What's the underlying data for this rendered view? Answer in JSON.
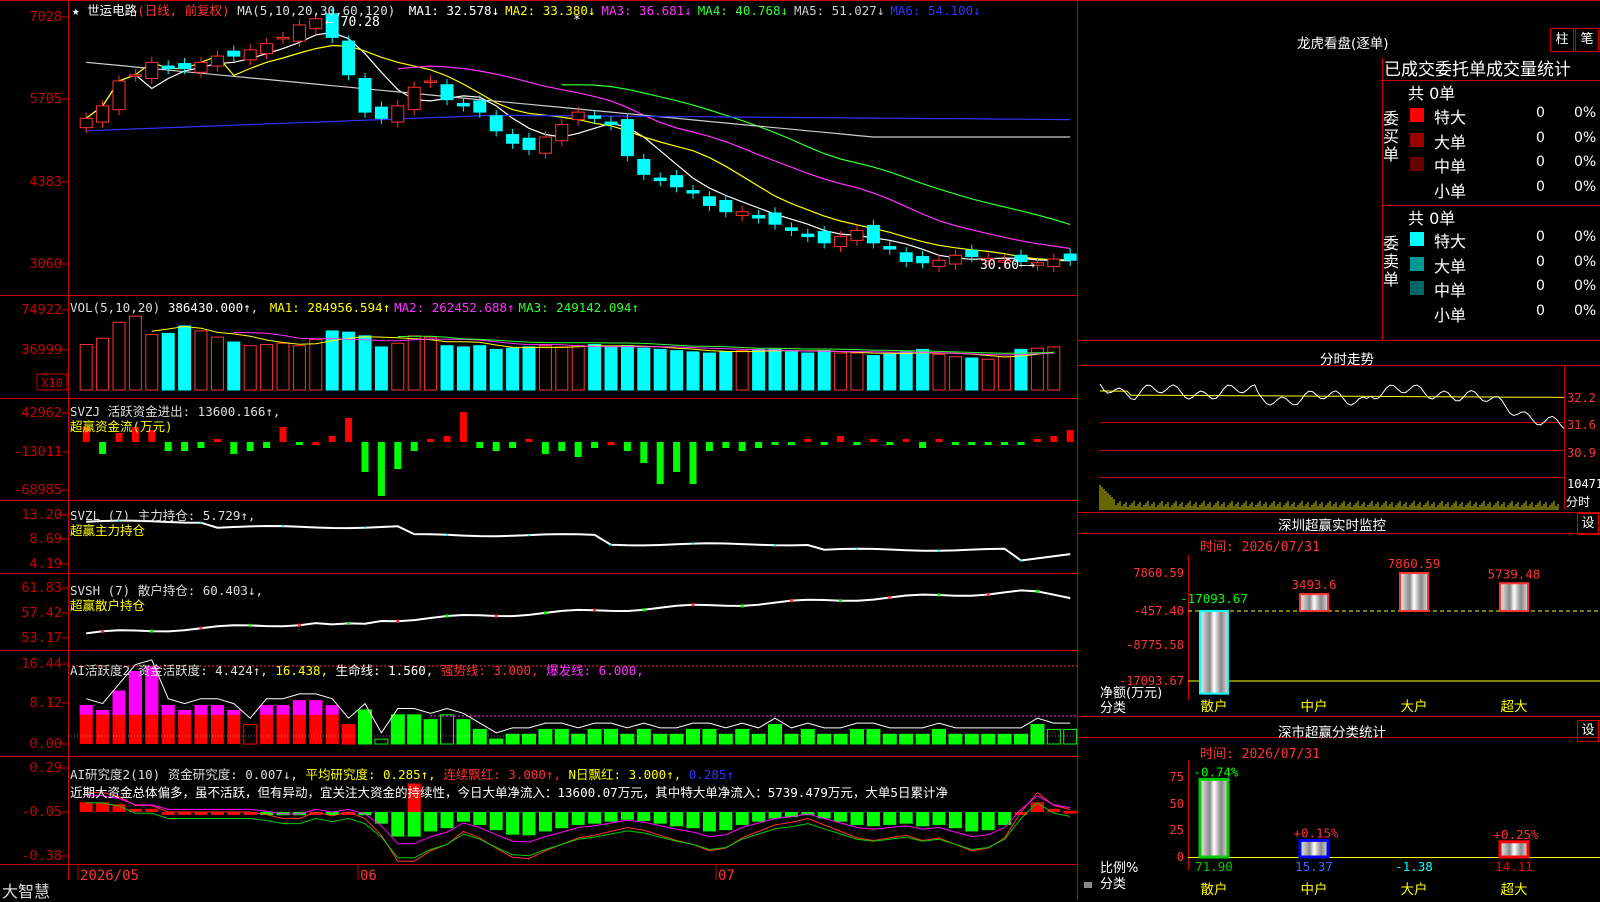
{
  "stock": {
    "name": "世运电路",
    "period_label": "(日线, 前复权)",
    "star": "★",
    "ma_header": "MA(5,10,20,30,60,120)",
    "ma": [
      {
        "label": "MA1:",
        "value": "32.578↓",
        "color": "#ffffff"
      },
      {
        "label": "MA2:",
        "value": "33.380↓",
        "color": "#ffff00"
      },
      {
        "label": "MA3:",
        "value": "36.681↓",
        "color": "#ff33ff"
      },
      {
        "label": "MA4:",
        "value": "40.768↓",
        "color": "#33ff33"
      },
      {
        "label": "MA5:",
        "value": "51.027↓",
        "color": "#cccccc"
      },
      {
        "label": "MA6:",
        "value": "54.100↓",
        "color": "#3333ff"
      }
    ],
    "price_axis": [
      "7028",
      "5705",
      "4383",
      "3060"
    ],
    "high_marker": "70.28",
    "low_marker": "30.60"
  },
  "vol": {
    "header": "VOL(5,10,20)",
    "value": "386430.000↑",
    "ma": [
      {
        "label": "MA1:",
        "value": "284956.594↑",
        "color": "#ffff00"
      },
      {
        "label": "MA2:",
        "value": "262452.688↑",
        "color": "#ff33ff"
      },
      {
        "label": "MA3:",
        "value": "249142.094↑",
        "color": "#33ff33"
      }
    ],
    "axis": [
      "74922",
      "36999"
    ],
    "unit": "X10"
  },
  "svzj": {
    "header": "SVZJ  活跃资金进出: 13600.166↑,",
    "sub": "超赢资金流(万元)",
    "axis": [
      "42962",
      "-13011",
      "-68985"
    ]
  },
  "svzl": {
    "header": "SVZL (7) 主力持仓: 5.729↑,",
    "sub": "超赢主力持仓",
    "axis": [
      "13.20",
      "8.69",
      "4.19"
    ]
  },
  "svsh": {
    "header": "SVSH (7) 散户持仓: 60.403↓,",
    "sub": "超赢散户持仓",
    "axis": [
      "61.83",
      "57.42",
      "53.17"
    ]
  },
  "ai1": {
    "header_a": "AI活跃度2 资金活跃度: 4.424↑,",
    "header_b": "16.438,",
    "header_c": "生命线: 1.560,",
    "header_d": "强势线: 3.000,",
    "header_e": "爆发线: 6.000,",
    "axis": [
      "16.44",
      "8.12",
      "0.00"
    ]
  },
  "ai2": {
    "header_a": "AI研究度2(10) 资金研究度: 0.007↓,",
    "header_b": "平均研究度: 0.285↑,",
    "header_c": "连续飘红: 3.000↑,",
    "header_d": "N日飘红: 3.000↑,",
    "header_e": "0.285↑",
    "comment": "近期大资金总体偏多，虽不活跃，但有异动，宜关注大资金的持续性，今日大单净流入：13600.07万元，其中特大单净流入：5739.479万元，大单5日累计净",
    "axis": [
      "0.29",
      "-0.05",
      "-0.38"
    ]
  },
  "footer": {
    "brand": "大智慧",
    "dates": [
      "2026/05",
      "06",
      "07"
    ]
  },
  "dragon": {
    "title": "龙虎看盘(逐单)",
    "btn_bar": "柱",
    "btn_pen": "笔",
    "subtitle": "已成交委托单成交量统计",
    "buy_side": "委买单",
    "sell_side": "委卖单",
    "buy_total": "共 0单",
    "sell_total": "共 0单",
    "buy_rows": [
      {
        "label": "特大",
        "count": "0",
        "pct": "0%",
        "color": "#ff0000"
      },
      {
        "label": "大单",
        "count": "0",
        "pct": "0%",
        "color": "#990000"
      },
      {
        "label": "中单",
        "count": "0",
        "pct": "0%",
        "color": "#660000"
      },
      {
        "label": "小单",
        "count": "0",
        "pct": "0%",
        "color": "#000000"
      }
    ],
    "sell_rows": [
      {
        "label": "特大",
        "count": "0",
        "pct": "0%",
        "color": "#00ffff"
      },
      {
        "label": "大单",
        "count": "0",
        "pct": "0%",
        "color": "#009999"
      },
      {
        "label": "中单",
        "count": "0",
        "pct": "0%",
        "color": "#006666"
      },
      {
        "label": "小单",
        "count": "0",
        "pct": "0%",
        "color": "#000000"
      }
    ]
  },
  "intraday": {
    "title": "分时走势",
    "axis": [
      "32.2",
      "31.6",
      "30.9"
    ],
    "vol_label": "10471",
    "vol_unit": "分时"
  },
  "sz_monitor": {
    "title": "深圳超赢实时监控",
    "settings": "设",
    "time": "时间: 2026/07/31",
    "axis": [
      "7860.59",
      "-457.40",
      "-8775.58",
      "-17093.67"
    ],
    "ylabel": "净额(万元)",
    "xlabel": "分类",
    "categories": [
      "散户",
      "中户",
      "大户",
      "超大"
    ],
    "values": [
      "-17093.67",
      "3493.6",
      "7860.59",
      "5739.48"
    ]
  },
  "sz_class": {
    "title": "深市超赢分类统计",
    "settings": "设",
    "time": "时间: 2026/07/31",
    "axis": [
      "75",
      "50",
      "25",
      "0"
    ],
    "ylabel": "比例%",
    "xlabel": "分类",
    "categories": [
      "散户",
      "中户",
      "大户",
      "超大"
    ],
    "top_labels": [
      "-0.74%",
      "+0.15%",
      "",
      "+0.25%"
    ],
    "bottom_values": [
      "71.90",
      "15.37",
      "-1.38",
      "14.11"
    ]
  },
  "chart_data": [
    {
      "type": "candlestick",
      "title": "世运电路 (日线, 前复权)",
      "ylim": [
        30.6,
        70.28
      ],
      "close": [
        54,
        56,
        60,
        61,
        63,
        62,
        62,
        63,
        64,
        64,
        65,
        66,
        67,
        69,
        70,
        67,
        61,
        55,
        54,
        56,
        59,
        60,
        57,
        56,
        55,
        52,
        50,
        49,
        51,
        53,
        55,
        54,
        53,
        48,
        45,
        44,
        43,
        42,
        40,
        39,
        39,
        38,
        37,
        36,
        35,
        34,
        35,
        36,
        34,
        33,
        31,
        30.8,
        31.2,
        32,
        31.8,
        31.5,
        31.2,
        31,
        30.8,
        31.4,
        31.2
      ]
    },
    {
      "type": "bar",
      "title": "VOL(5,10,20)",
      "values": [
        37,
        42,
        55,
        60,
        45,
        46,
        52,
        48,
        43,
        39,
        36,
        37,
        38,
        36,
        41,
        48,
        47,
        44,
        35,
        38,
        44,
        43,
        36,
        35,
        36,
        33,
        34,
        35,
        36,
        35,
        36,
        37,
        35,
        36,
        34,
        33,
        32,
        31,
        30,
        31,
        32,
        33,
        33,
        31,
        30,
        32,
        30,
        30,
        28,
        29,
        31,
        33,
        29,
        27,
        26,
        25,
        27,
        33,
        34,
        35
      ]
    },
    {
      "type": "bar",
      "title": "SVZJ 超赢资金流(万元)",
      "values": [
        5,
        -4,
        3,
        5,
        4,
        -3,
        -3,
        -2,
        1,
        -4,
        -3,
        -2,
        5,
        -1,
        0,
        2,
        8,
        -10,
        -18,
        -9,
        -3,
        1,
        2,
        10,
        -2,
        -3,
        -2,
        1,
        -4,
        -3,
        -5,
        -2,
        0,
        -3,
        -7,
        -14,
        -10,
        -14,
        -3,
        -2,
        -3,
        -2,
        -1,
        -1,
        1,
        -1,
        2,
        -1,
        1,
        -1,
        1,
        -2,
        1,
        -1,
        -1,
        -1,
        -1,
        -1,
        1,
        2,
        4
      ]
    }
  ]
}
